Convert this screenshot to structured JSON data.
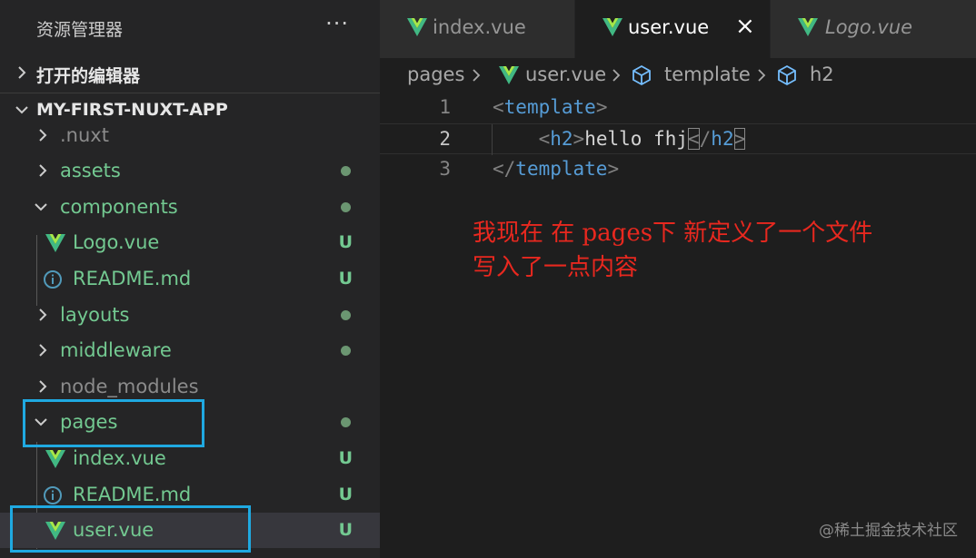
{
  "sidebar": {
    "title": "资源管理器",
    "more": "···",
    "open_editors": "打开的编辑器",
    "project": "MY-FIRST-NUXT-APP",
    "items": [
      {
        "name": ".nuxt",
        "type": "folder-muted",
        "status": ""
      },
      {
        "name": "assets",
        "type": "folder",
        "status": "dot"
      },
      {
        "name": "components",
        "type": "folder-open",
        "status": "dot"
      },
      {
        "name": "Logo.vue",
        "type": "vue",
        "status": "U"
      },
      {
        "name": "README.md",
        "type": "info",
        "status": "U"
      },
      {
        "name": "layouts",
        "type": "folder",
        "status": "dot"
      },
      {
        "name": "middleware",
        "type": "folder",
        "status": "dot"
      },
      {
        "name": "node_modules",
        "type": "folder-muted",
        "status": ""
      },
      {
        "name": "pages",
        "type": "folder-open",
        "status": "dot"
      },
      {
        "name": "index.vue",
        "type": "vue",
        "status": "U"
      },
      {
        "name": "README.md",
        "type": "info",
        "status": "U"
      },
      {
        "name": "user.vue",
        "type": "vue",
        "status": "U"
      }
    ]
  },
  "tabs": [
    {
      "label": "index.vue",
      "active": false
    },
    {
      "label": "user.vue",
      "active": true,
      "close": "×"
    },
    {
      "label": "Logo.vue",
      "active": false
    }
  ],
  "breadcrumb": {
    "root": "pages",
    "file": "user.vue",
    "sym1": "template",
    "sym2": "h2"
  },
  "code": {
    "lines": [
      {
        "num": "1",
        "open": "<",
        "tag": "template",
        "close": ">"
      },
      {
        "num": "2",
        "indent": "    ",
        "tag_open": "h2",
        "text": "hello fhj",
        "tag_close": "h2"
      },
      {
        "num": "3",
        "open": "</",
        "tag": "template",
        "close": ">"
      }
    ]
  },
  "annotation": {
    "line1": "我现在 在 pages下 新定义了一个文件",
    "line2": "写入了一点内容"
  },
  "watermark": "@稀土掘金技术社区",
  "colors": {
    "vue_green": "#41b883",
    "highlight": "#1fa9e1",
    "annotation": "#e8281f"
  }
}
